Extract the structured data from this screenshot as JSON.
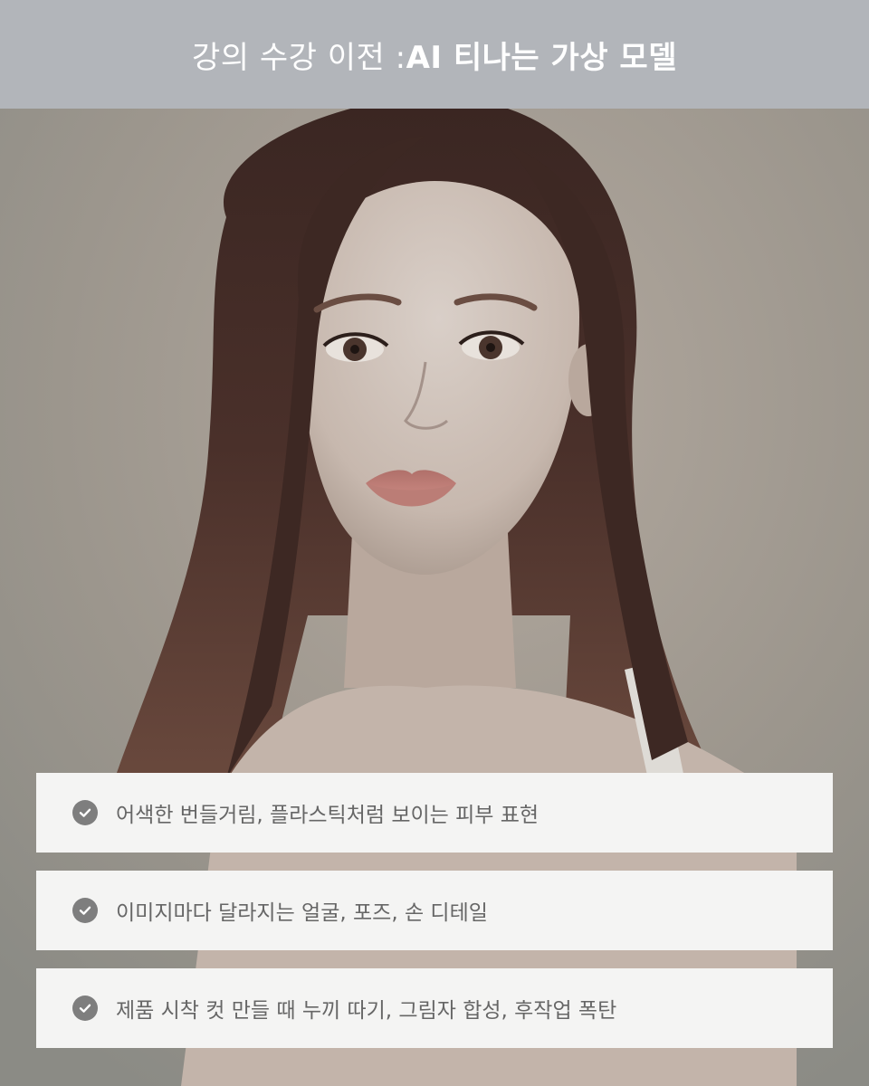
{
  "header": {
    "title_prefix": "강의 수강 이전 : ",
    "title_emphasis": "AI 티나는 가상 모델"
  },
  "photo": {
    "alt": "AI 가상 모델 인물 사진"
  },
  "checklist": {
    "items": [
      {
        "icon": "check-circle-icon",
        "text": " 어색한 번들거림, 플라스틱처럼 보이는 피부 표현"
      },
      {
        "icon": "check-circle-icon",
        "text": "이미지마다 달라지는 얼굴, 포즈, 손 디테일"
      },
      {
        "icon": "check-circle-icon",
        "text": "제품 시착 컷 만들 때 누끼 따기, 그림자 합성, 후작업 폭탄"
      }
    ]
  },
  "colors": {
    "header_bg": "#b2b5ba",
    "page_bg": "#8e8e88",
    "card_bg": "#f4f4f3",
    "check_icon": "#7e7e7e",
    "text": "#666666"
  }
}
